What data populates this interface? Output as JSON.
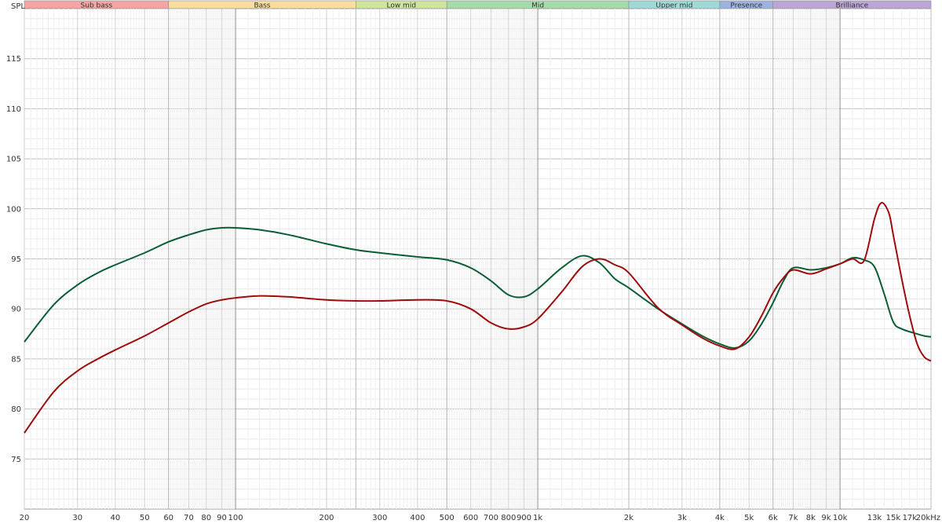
{
  "chart_data": {
    "type": "line",
    "ylabel": "SPL",
    "x_scale": "log",
    "xlim": [
      20,
      20000
    ],
    "ylim": [
      70,
      120
    ],
    "grid": true,
    "bands": [
      {
        "label": "Sub bass",
        "from": 20,
        "to": 60,
        "color": "#f4a4a4"
      },
      {
        "label": "Bass",
        "from": 60,
        "to": 250,
        "color": "#f8dd9c"
      },
      {
        "label": "Low mid",
        "from": 250,
        "to": 500,
        "color": "#cfe59e"
      },
      {
        "label": "Mid",
        "from": 500,
        "to": 2000,
        "color": "#a3dca8"
      },
      {
        "label": "Upper mid",
        "from": 2000,
        "to": 4000,
        "color": "#9ed9d6"
      },
      {
        "label": "Presence",
        "from": 4000,
        "to": 6000,
        "color": "#9db3df"
      },
      {
        "label": "Brilliance",
        "from": 6000,
        "to": 20000,
        "color": "#bba5d4"
      }
    ],
    "x_ticks": [
      {
        "v": 20,
        "t": "20"
      },
      {
        "v": 30,
        "t": "30"
      },
      {
        "v": 40,
        "t": "40"
      },
      {
        "v": 50,
        "t": "50"
      },
      {
        "v": 60,
        "t": "60"
      },
      {
        "v": 70,
        "t": "70"
      },
      {
        "v": 80,
        "t": "80"
      },
      {
        "v": 90,
        "t": "90"
      },
      {
        "v": 100,
        "t": "100"
      },
      {
        "v": 200,
        "t": "200"
      },
      {
        "v": 300,
        "t": "300"
      },
      {
        "v": 400,
        "t": "400"
      },
      {
        "v": 500,
        "t": "500"
      },
      {
        "v": 600,
        "t": "600"
      },
      {
        "v": 700,
        "t": "700"
      },
      {
        "v": 800,
        "t": "800"
      },
      {
        "v": 900,
        "t": "900"
      },
      {
        "v": 1000,
        "t": "1k"
      },
      {
        "v": 2000,
        "t": "2k"
      },
      {
        "v": 3000,
        "t": "3k"
      },
      {
        "v": 4000,
        "t": "4k"
      },
      {
        "v": 5000,
        "t": "5k"
      },
      {
        "v": 6000,
        "t": "6k"
      },
      {
        "v": 7000,
        "t": "7k"
      },
      {
        "v": 8000,
        "t": "8k"
      },
      {
        "v": 9000,
        "t": "9k"
      },
      {
        "v": 10000,
        "t": "10k"
      },
      {
        "v": 13000,
        "t": "13k"
      },
      {
        "v": 15000,
        "t": "15k"
      },
      {
        "v": 17000,
        "t": "17k"
      },
      {
        "v": 20000,
        "t": "20kHz"
      }
    ],
    "y_ticks": [
      75,
      80,
      85,
      90,
      95,
      100,
      105,
      110,
      115
    ],
    "series": [
      {
        "color": "#0b5d36",
        "points": [
          [
            20,
            86.7
          ],
          [
            25,
            90.4
          ],
          [
            30,
            92.4
          ],
          [
            35,
            93.6
          ],
          [
            40,
            94.4
          ],
          [
            50,
            95.6
          ],
          [
            60,
            96.7
          ],
          [
            70,
            97.4
          ],
          [
            80,
            97.9
          ],
          [
            90,
            98.1
          ],
          [
            100,
            98.1
          ],
          [
            120,
            97.9
          ],
          [
            150,
            97.4
          ],
          [
            200,
            96.5
          ],
          [
            250,
            95.9
          ],
          [
            300,
            95.6
          ],
          [
            400,
            95.2
          ],
          [
            500,
            94.9
          ],
          [
            600,
            94.1
          ],
          [
            700,
            92.8
          ],
          [
            800,
            91.4
          ],
          [
            900,
            91.2
          ],
          [
            1000,
            92.0
          ],
          [
            1200,
            94.1
          ],
          [
            1400,
            95.3
          ],
          [
            1600,
            94.6
          ],
          [
            1800,
            93.0
          ],
          [
            2000,
            92.1
          ],
          [
            2500,
            90.0
          ],
          [
            3000,
            88.5
          ],
          [
            3500,
            87.3
          ],
          [
            4000,
            86.5
          ],
          [
            4500,
            86.1
          ],
          [
            5000,
            86.8
          ],
          [
            5500,
            88.5
          ],
          [
            6000,
            90.6
          ],
          [
            6500,
            92.8
          ],
          [
            7000,
            94.1
          ],
          [
            8000,
            93.9
          ],
          [
            9000,
            94.1
          ],
          [
            10000,
            94.5
          ],
          [
            11000,
            95.1
          ],
          [
            12000,
            94.9
          ],
          [
            13000,
            94.2
          ],
          [
            14000,
            91.5
          ],
          [
            15000,
            88.7
          ],
          [
            16000,
            88.0
          ],
          [
            18000,
            87.5
          ],
          [
            19000,
            87.3
          ],
          [
            20000,
            87.2
          ]
        ]
      },
      {
        "color": "#9e0c0c",
        "points": [
          [
            20,
            77.6
          ],
          [
            25,
            81.7
          ],
          [
            30,
            83.8
          ],
          [
            35,
            85.0
          ],
          [
            40,
            85.9
          ],
          [
            50,
            87.3
          ],
          [
            60,
            88.6
          ],
          [
            70,
            89.7
          ],
          [
            80,
            90.5
          ],
          [
            90,
            90.9
          ],
          [
            100,
            91.1
          ],
          [
            120,
            91.3
          ],
          [
            150,
            91.2
          ],
          [
            200,
            90.9
          ],
          [
            250,
            90.8
          ],
          [
            300,
            90.8
          ],
          [
            400,
            90.9
          ],
          [
            500,
            90.8
          ],
          [
            600,
            90.0
          ],
          [
            700,
            88.6
          ],
          [
            800,
            88.0
          ],
          [
            900,
            88.2
          ],
          [
            1000,
            89.0
          ],
          [
            1200,
            91.7
          ],
          [
            1400,
            94.2
          ],
          [
            1600,
            95.0
          ],
          [
            1800,
            94.4
          ],
          [
            2000,
            93.6
          ],
          [
            2500,
            90.1
          ],
          [
            3000,
            88.4
          ],
          [
            3500,
            87.1
          ],
          [
            4000,
            86.3
          ],
          [
            4500,
            86.0
          ],
          [
            5000,
            87.2
          ],
          [
            5500,
            89.3
          ],
          [
            6000,
            91.6
          ],
          [
            6500,
            93.1
          ],
          [
            7000,
            93.9
          ],
          [
            8000,
            93.5
          ],
          [
            9000,
            94.0
          ],
          [
            10000,
            94.5
          ],
          [
            11000,
            95.0
          ],
          [
            12000,
            94.8
          ],
          [
            13000,
            99.0
          ],
          [
            13700,
            100.6
          ],
          [
            14500,
            99.6
          ],
          [
            15000,
            97.4
          ],
          [
            16000,
            93.0
          ],
          [
            17000,
            89.3
          ],
          [
            18000,
            86.5
          ],
          [
            19000,
            85.2
          ],
          [
            20000,
            84.8
          ]
        ]
      }
    ]
  }
}
